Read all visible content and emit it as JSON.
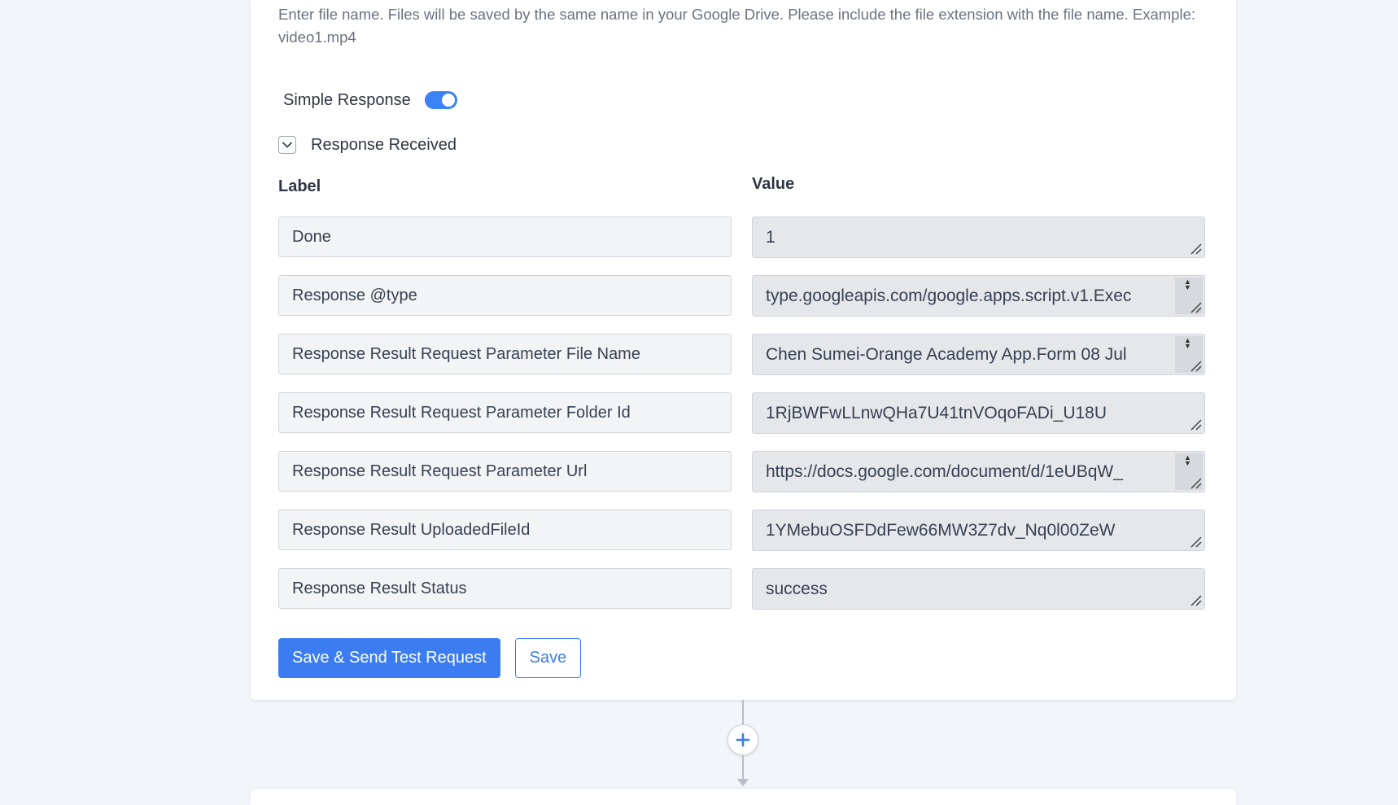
{
  "helper_text": "Enter file name. Files will be saved by the same name in your Google Drive. Please include the file extension with the file name. Example: video1.mp4",
  "simple_response": {
    "label": "Simple Response",
    "enabled": true
  },
  "response_received": {
    "label": "Response Received",
    "icon": "chevron-down-icon"
  },
  "columns": {
    "label": "Label",
    "value": "Value"
  },
  "rows": [
    {
      "label": "Done",
      "value": "1"
    },
    {
      "label": "Response @type",
      "value": "type.googleapis.com/google.apps.script.v1.Exec"
    },
    {
      "label": "Response Result Request Parameter File Name",
      "value": "Chen Sumei-Orange Academy App.Form 08 Jul"
    },
    {
      "label": "Response Result Request Parameter Folder Id",
      "value": "1RjBWFwLLnwQHa7U41tnVOqoFADi_U18U"
    },
    {
      "label": "Response Result Request Parameter Url",
      "value": "https://docs.google.com/document/d/1eUBqW_"
    },
    {
      "label": "Response Result UploadedFileId",
      "value": "1YMebuOSFDdFew66MW3Z7dv_Nq0l00ZeW"
    },
    {
      "label": "Response Result Status",
      "value": "success"
    }
  ],
  "buttons": {
    "save_send": "Save & Send Test Request",
    "save": "Save"
  },
  "add_step_icon": "plus-icon",
  "colors": {
    "accent": "#3b7cf1",
    "background": "#f2f5f9"
  }
}
